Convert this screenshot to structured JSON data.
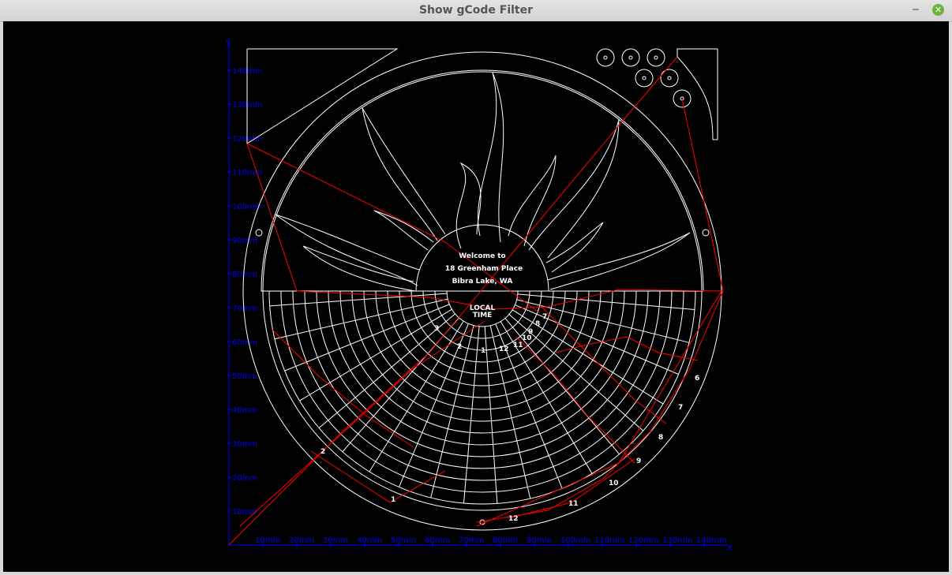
{
  "window": {
    "title": "Show gCode Filter",
    "minimize_icon": "minimize-icon",
    "close_icon": "close-icon",
    "close_color": "#6fb33a"
  },
  "plot": {
    "background": "#000000",
    "axis_color": "#0000ff",
    "cut_color": "#ffffff",
    "travel_color": "#ff0000",
    "x_axis_label": "X",
    "y_axis_label": "Y",
    "x_ticks": [
      "10mm",
      "20mm",
      "30mm",
      "40mm",
      "50mm",
      "60mm",
      "70mm",
      "80mm",
      "90mm",
      "100mm",
      "110mm",
      "120mm",
      "130mm",
      "140mm"
    ],
    "y_ticks": [
      "10mm",
      "20mm",
      "30mm",
      "40mm",
      "50mm",
      "60mm",
      "70mm",
      "80mm",
      "90mm",
      "100mm",
      "110mm",
      "120mm",
      "130mm",
      "140mm"
    ],
    "engraving": {
      "line1": "Welcome to",
      "line2": "18 Greenham Place",
      "line3": "Bibra Lake, WA",
      "local_time_1": "LOCAL",
      "local_time_2": "TIME",
      "outer_hours": [
        "2",
        "1",
        "12",
        "11",
        "10",
        "9",
        "8",
        "7",
        "6"
      ],
      "inner_hours": [
        "3",
        "2",
        "1",
        "12",
        "11",
        "10",
        "9",
        "8",
        "7"
      ]
    }
  }
}
